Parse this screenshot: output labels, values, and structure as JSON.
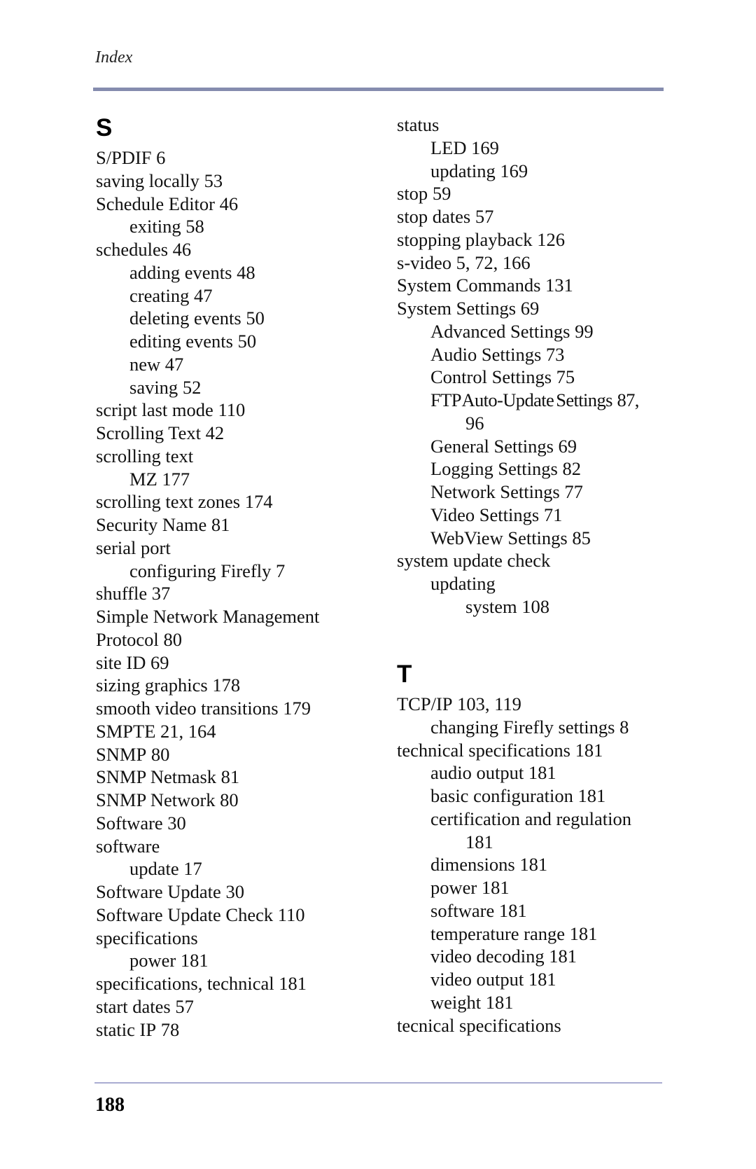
{
  "header": {
    "running_title": "Index"
  },
  "footer": {
    "page_number": "188"
  },
  "columns": [
    {
      "sections": [
        {
          "letter": "S",
          "entries": [
            {
              "term": "S/PDIF",
              "pages": "6",
              "level": 0
            },
            {
              "term": "saving locally",
              "pages": "53",
              "level": 0
            },
            {
              "term": "Schedule Editor",
              "pages": "46",
              "level": 0
            },
            {
              "term": "exiting",
              "pages": "58",
              "level": 1
            },
            {
              "term": "schedules",
              "pages": "46",
              "level": 0
            },
            {
              "term": "adding events",
              "pages": "48",
              "level": 1
            },
            {
              "term": "creating",
              "pages": "47",
              "level": 1
            },
            {
              "term": "deleting events",
              "pages": "50",
              "level": 1
            },
            {
              "term": "editing events",
              "pages": "50",
              "level": 1
            },
            {
              "term": "new",
              "pages": "47",
              "level": 1
            },
            {
              "term": "saving",
              "pages": "52",
              "level": 1
            },
            {
              "term": "script last mode",
              "pages": "110",
              "level": 0
            },
            {
              "term": "Scrolling Text",
              "pages": "42",
              "level": 0
            },
            {
              "term": "scrolling text",
              "pages": "",
              "level": 0
            },
            {
              "term": "MZ",
              "pages": "177",
              "level": 1
            },
            {
              "term": "scrolling text zones",
              "pages": "174",
              "level": 0
            },
            {
              "term": "Security Name",
              "pages": "81",
              "level": 0
            },
            {
              "term": "serial port",
              "pages": "",
              "level": 0
            },
            {
              "term": "configuring Firefly",
              "pages": "7",
              "level": 1
            },
            {
              "term": "shuffle",
              "pages": "37",
              "level": 0
            },
            {
              "term": "Simple Network Management",
              "pages": "",
              "level": 0
            },
            {
              "term": "Protocol",
              "pages": "80",
              "level": 0
            },
            {
              "term": "site ID",
              "pages": "69",
              "level": 0
            },
            {
              "term": "sizing graphics",
              "pages": "178",
              "level": 0
            },
            {
              "term": "smooth video transitions",
              "pages": "179",
              "level": 0
            },
            {
              "term": "SMPTE",
              "pages": "21, 164",
              "level": 0
            },
            {
              "term": "SNMP",
              "pages": "80",
              "level": 0
            },
            {
              "term": "SNMP Netmask",
              "pages": "81",
              "level": 0
            },
            {
              "term": "SNMP Network",
              "pages": "80",
              "level": 0
            },
            {
              "term": "Software",
              "pages": "30",
              "level": 0
            },
            {
              "term": "software",
              "pages": "",
              "level": 0
            },
            {
              "term": "update",
              "pages": "17",
              "level": 1
            },
            {
              "term": "Software Update",
              "pages": "30",
              "level": 0
            },
            {
              "term": "Software Update Check",
              "pages": "110",
              "level": 0
            },
            {
              "term": "specifications",
              "pages": "",
              "level": 0
            },
            {
              "term": "power",
              "pages": "181",
              "level": 1
            },
            {
              "term": "specifications, technical",
              "pages": "181",
              "level": 0
            },
            {
              "term": "start dates",
              "pages": "57",
              "level": 0
            },
            {
              "term": "static IP",
              "pages": "78",
              "level": 0
            }
          ]
        }
      ]
    },
    {
      "sections": [
        {
          "letter": "",
          "entries": [
            {
              "term": "status",
              "pages": "",
              "level": 0
            },
            {
              "term": "LED",
              "pages": "169",
              "level": 1
            },
            {
              "term": "updating",
              "pages": "169",
              "level": 1
            },
            {
              "term": "stop",
              "pages": "59",
              "level": 0
            },
            {
              "term": "stop dates",
              "pages": "57",
              "level": 0
            },
            {
              "term": "stopping playback",
              "pages": "126",
              "level": 0
            },
            {
              "term": "s-video",
              "pages": "5, 72, 166",
              "level": 0
            },
            {
              "term": "System Commands",
              "pages": "131",
              "level": 0
            },
            {
              "term": "System Settings",
              "pages": "69",
              "level": 0
            },
            {
              "term": "Advanced Settings",
              "pages": "99",
              "level": 1
            },
            {
              "term": "Audio Settings",
              "pages": "73",
              "level": 1
            },
            {
              "term": "Control Settings",
              "pages": "75",
              "level": 1
            },
            {
              "term": "FTP Auto-Update Settings",
              "pages": "87,",
              "level": 1
            },
            {
              "term": "",
              "pages": "96",
              "level": 2
            },
            {
              "term": "General Settings",
              "pages": "69",
              "level": 1
            },
            {
              "term": "Logging Settings",
              "pages": "82",
              "level": 1
            },
            {
              "term": "Network Settings",
              "pages": "77",
              "level": 1
            },
            {
              "term": "Video Settings",
              "pages": "71",
              "level": 1
            },
            {
              "term": "WebView Settings",
              "pages": "85",
              "level": 1
            },
            {
              "term": "system update check",
              "pages": "",
              "level": 0
            },
            {
              "term": "updating",
              "pages": "",
              "level": 1
            },
            {
              "term": "system",
              "pages": "108",
              "level": 2
            }
          ]
        },
        {
          "letter": "T",
          "entries": [
            {
              "term": "TCP/IP",
              "pages": "103, 119",
              "level": 0
            },
            {
              "term": "changing Firefly settings",
              "pages": "8",
              "level": 1
            },
            {
              "term": "technical specifications",
              "pages": "181",
              "level": 0
            },
            {
              "term": "audio output",
              "pages": "181",
              "level": 1
            },
            {
              "term": "basic configuration",
              "pages": "181",
              "level": 1
            },
            {
              "term": "certification and regulation",
              "pages": "",
              "level": 1
            },
            {
              "term": "",
              "pages": "181",
              "level": 2
            },
            {
              "term": "dimensions",
              "pages": "181",
              "level": 1
            },
            {
              "term": "power",
              "pages": "181",
              "level": 1
            },
            {
              "term": "software",
              "pages": "181",
              "level": 1
            },
            {
              "term": "temperature range",
              "pages": "181",
              "level": 1
            },
            {
              "term": "video decoding",
              "pages": "181",
              "level": 1
            },
            {
              "term": "video output",
              "pages": "181",
              "level": 1
            },
            {
              "term": "weight",
              "pages": "181",
              "level": 1
            },
            {
              "term": "tecnical specifications",
              "pages": "",
              "level": 0
            }
          ]
        }
      ]
    }
  ]
}
